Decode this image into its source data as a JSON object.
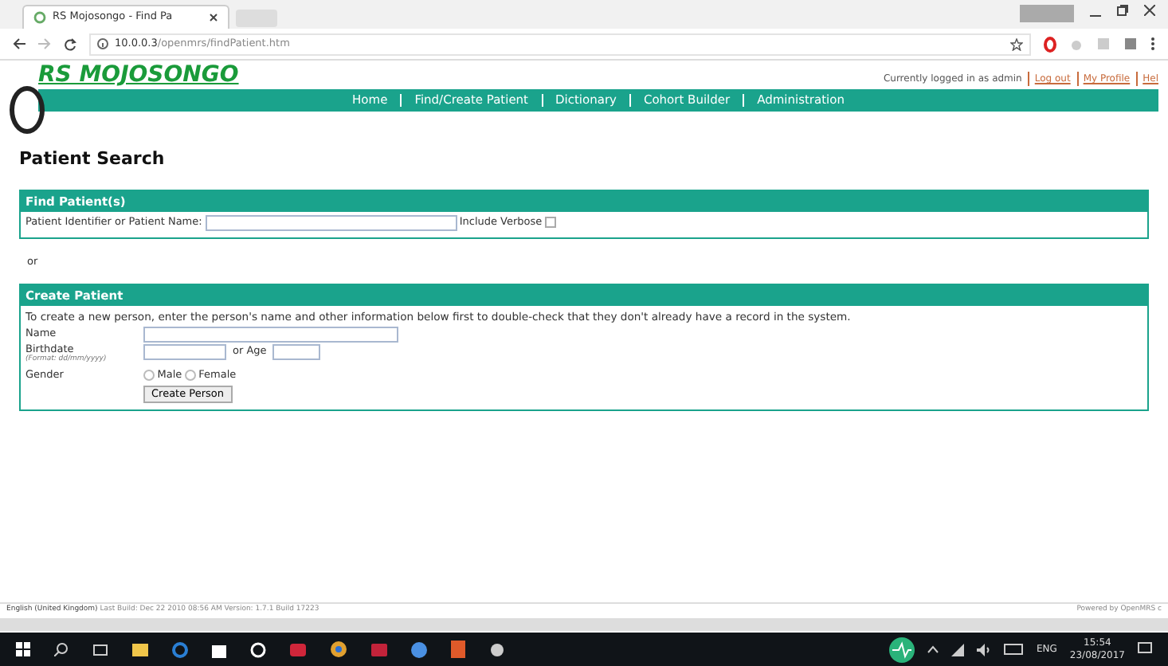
{
  "browser": {
    "tab_title": "RS Mojosongo - Find Pa",
    "url_host": "10.0.0.3",
    "url_path": "/openmrs/findPatient.htm"
  },
  "header": {
    "logo_text": "RS MOJOSONGO",
    "login_text": "Currently logged in as admin",
    "links": [
      "Log out",
      "My Profile",
      "Hel"
    ]
  },
  "nav": {
    "items": [
      "Home",
      "Find/Create Patient",
      "Dictionary",
      "Cohort Builder",
      "Administration"
    ]
  },
  "page_title": "Patient Search",
  "find_section": {
    "title": "Find Patient(s)",
    "field_label": "Patient Identifier or Patient Name:",
    "verbose_label": "Include Verbose",
    "verbose_checked": false
  },
  "or_text": "or",
  "create_section": {
    "title": "Create Patient",
    "intro": "To create a new person, enter the person's name and other information below first to double-check that they don't already have a record in the system.",
    "name_label": "Name",
    "birthdate_label": "Birthdate",
    "birthdate_hint": "(Format: dd/mm/yyyy)",
    "age_label": "or Age",
    "gender_label": "Gender",
    "genders": [
      {
        "label": "Male",
        "selected": false
      },
      {
        "label": "Female",
        "selected": false
      }
    ],
    "button": "Create Person"
  },
  "footer": {
    "locale": "English (United Kingdom)",
    "build_info": "Last Build: Dec 22 2010 08:56 AM  Version: 1.7.1 Build 17223",
    "powered_by": "Powered by OpenMRS c"
  },
  "taskbar": {
    "language": "ENG",
    "time": "15:54",
    "date": "23/08/2017"
  }
}
